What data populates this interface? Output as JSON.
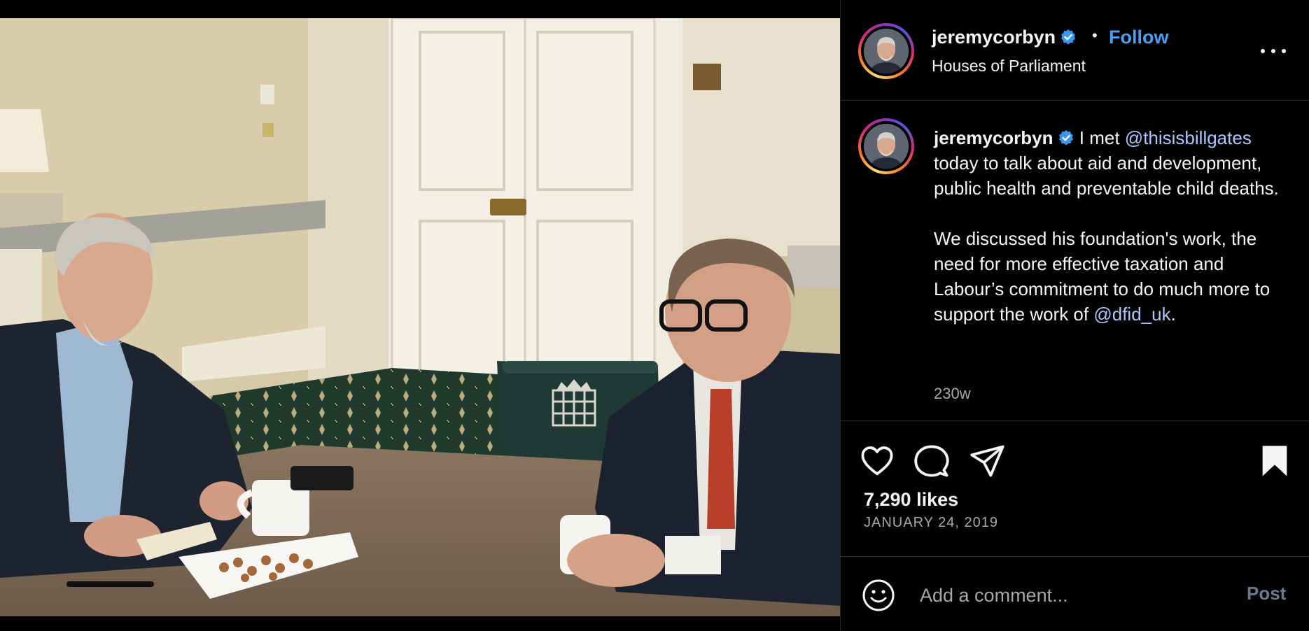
{
  "header": {
    "username": "jeremycorbyn",
    "follow_label": "Follow",
    "separator": "•",
    "location": "Houses of Parliament"
  },
  "caption": {
    "username": "jeremycorbyn",
    "line1_start": "I met",
    "mention1": "@thisisbillgates",
    "line1_rest": "today to talk about aid and development, public health and preventable child deaths.",
    "para2": "We discussed his foundation's work, the need for more effective taxation and Labour’s commitment to do much more to support the work of",
    "mention2": "@dfid_uk",
    "para2_end": ".",
    "age": "230w"
  },
  "engagement": {
    "likes": "7,290 likes",
    "date": "JANUARY 24, 2019"
  },
  "comment": {
    "placeholder": "Add a comment...",
    "post_label": "Post"
  },
  "icons": {
    "verified": "verified-badge-icon",
    "more": "more-options-icon",
    "like": "heart-icon",
    "comment": "comment-bubble-icon",
    "share": "paper-plane-icon",
    "save": "bookmark-icon",
    "emoji": "smiley-icon"
  },
  "colors": {
    "background": "#000000",
    "accent_blue": "#4a9ff5",
    "verified_blue": "#3897f0",
    "muted_text": "#a8a8a8",
    "divider": "#262626"
  }
}
